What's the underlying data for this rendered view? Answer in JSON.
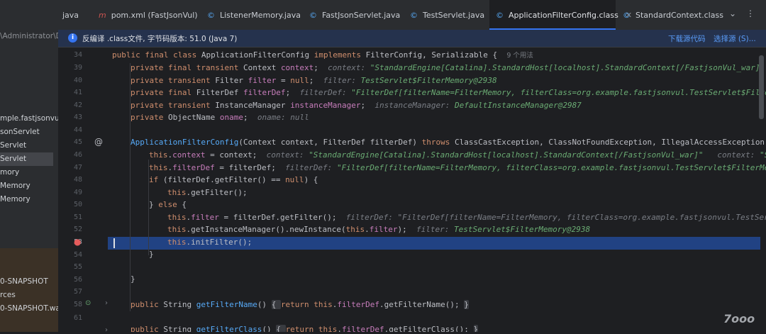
{
  "tabs": [
    {
      "label": "java",
      "icon": "",
      "active": false
    },
    {
      "label": "pom.xml (FastJsonVul)",
      "icon": "m",
      "active": false
    },
    {
      "label": "ListenerMemory.java",
      "icon": "©",
      "active": false
    },
    {
      "label": "FastJsonServlet.java",
      "icon": "©",
      "active": false
    },
    {
      "label": "TestServlet.java",
      "icon": "©",
      "active": false
    },
    {
      "label": "ApplicationFilterConfig.class",
      "icon": "©",
      "active": true
    },
    {
      "label": "StandardContext.class",
      "icon": "©",
      "active": false
    }
  ],
  "tab_controls": {
    "dropdown": "⌄",
    "more": "⋮"
  },
  "sidebar": {
    "path": "\\Administrator\\De",
    "items": [
      {
        "label": "mple.fastjsonvul"
      },
      {
        "label": "sonServlet"
      },
      {
        "label": "Servlet"
      },
      {
        "label": "Servlet"
      },
      {
        "label": "mory"
      },
      {
        "label": "Memory"
      },
      {
        "label": "Memory"
      }
    ],
    "lower_items": [
      {
        "label": "0-SNAPSHOT"
      },
      {
        "label": "rces"
      },
      {
        "label": "0-SNAPSHOT.war"
      }
    ]
  },
  "notice": {
    "message": "反编译 .class文件, 字节码版本: 51.0 (Java 7)",
    "download_link": "下载源代码",
    "select_link": "选择源 (S)..."
  },
  "code": {
    "line_numbers": [
      "34",
      "39",
      "40",
      "41",
      "42",
      "43",
      "44",
      "45",
      "46",
      "47",
      "48",
      "49",
      "50",
      "51",
      "52",
      "53",
      "54",
      "55",
      "56",
      "57",
      "58",
      "61"
    ],
    "usage_hint": "9 个用法",
    "current_line": "53",
    "watermark": "7ooo"
  },
  "colors": {
    "accent": "#3574f0",
    "keyword": "#cf8e6d",
    "field": "#c77dbb",
    "method": "#57aaf7",
    "string": "#6aab73",
    "selection": "#214283"
  }
}
